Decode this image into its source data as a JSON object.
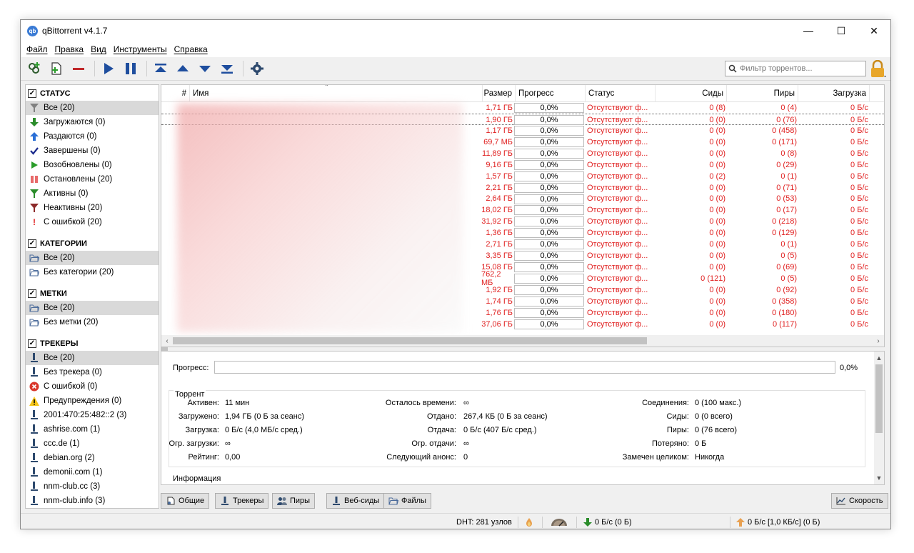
{
  "window": {
    "title": "qBittorrent v4.1.7",
    "controls": {
      "minimize": "—",
      "maximize": "☐",
      "close": "✕"
    }
  },
  "menu": [
    "Файл",
    "Правка",
    "Вид",
    "Инструменты",
    "Справка"
  ],
  "toolbar": {
    "buttons": [
      "add-link-icon",
      "add-file-icon",
      "remove-icon",
      "resume-icon",
      "pause-icon",
      "move-top-icon",
      "move-up-icon",
      "move-down-icon",
      "move-bottom-icon",
      "settings-icon"
    ],
    "filter_placeholder": "Фильтр торрентов...",
    "accent": "#1f4e9e"
  },
  "sidebar": {
    "status": {
      "title": "СТАТУС",
      "items": [
        {
          "label": "Все (20)",
          "icon": "filter-icon",
          "color": "#808080",
          "selected": true
        },
        {
          "label": "Загружаются (0)",
          "icon": "arrow-down-icon",
          "color": "#2a8c2a"
        },
        {
          "label": "Раздаются (0)",
          "icon": "arrow-up-icon",
          "color": "#2a6fd6"
        },
        {
          "label": "Завершены (0)",
          "icon": "checkmark-icon",
          "color": "#1a2a8c"
        },
        {
          "label": "Возобновлены (0)",
          "icon": "play-icon",
          "color": "#2a9c2a"
        },
        {
          "label": "Остановлены (20)",
          "icon": "pause-icon",
          "color": "#e86a6a"
        },
        {
          "label": "Активны (0)",
          "icon": "filter-icon",
          "color": "#2a8c2a"
        },
        {
          "label": "Неактивны (20)",
          "icon": "filter-icon",
          "color": "#8c2a2a"
        },
        {
          "label": "С ошибкой (20)",
          "icon": "exclamation-icon",
          "color": "#e02020"
        }
      ]
    },
    "categories": {
      "title": "КАТЕГОРИИ",
      "items": [
        {
          "label": "Все (20)",
          "selected": true
        },
        {
          "label": "Без категории (20)"
        }
      ]
    },
    "tags": {
      "title": "МЕТКИ",
      "items": [
        {
          "label": "Все (20)",
          "selected": true
        },
        {
          "label": "Без метки (20)"
        }
      ]
    },
    "trackers": {
      "title": "ТРЕКЕРЫ",
      "items": [
        {
          "label": "Все (20)",
          "icon": "tracker-icon",
          "selected": true
        },
        {
          "label": "Без трекера (0)",
          "icon": "tracker-icon"
        },
        {
          "label": "С ошибкой (0)",
          "icon": "error-circle-icon"
        },
        {
          "label": "Предупреждения (0)",
          "icon": "warning-icon"
        },
        {
          "label": "2001:470:25:482::2 (3)",
          "icon": "tracker-icon"
        },
        {
          "label": "ashrise.com (1)",
          "icon": "tracker-icon"
        },
        {
          "label": "ccc.de (1)",
          "icon": "tracker-icon"
        },
        {
          "label": "debian.org (2)",
          "icon": "tracker-icon"
        },
        {
          "label": "demonii.com (1)",
          "icon": "tracker-icon"
        },
        {
          "label": "nnm-club.cc (3)",
          "icon": "tracker-icon"
        },
        {
          "label": "nnm-club.info (3)",
          "icon": "tracker-icon"
        }
      ]
    }
  },
  "table": {
    "columns": {
      "num": "#",
      "name": "Имя",
      "size": "Размер",
      "progress": "Прогресс",
      "status": "Статус",
      "seeds": "Сиды",
      "peers": "Пиры",
      "down": "Загрузка"
    },
    "rows": [
      {
        "size": "1,71 ГБ",
        "progress": "0,0%",
        "status": "Отсутствуют ф...",
        "seeds": "0 (8)",
        "peers": "0 (4)",
        "down": "0 Б/с"
      },
      {
        "size": "1,90 ГБ",
        "progress": "0,0%",
        "status": "Отсутствуют ф...",
        "seeds": "0 (0)",
        "peers": "0 (76)",
        "down": "0 Б/с"
      },
      {
        "size": "1,17 ГБ",
        "progress": "0,0%",
        "status": "Отсутствуют ф...",
        "seeds": "0 (0)",
        "peers": "0 (458)",
        "down": "0 Б/с"
      },
      {
        "size": "69,7 МБ",
        "progress": "0,0%",
        "status": "Отсутствуют ф...",
        "seeds": "0 (0)",
        "peers": "0 (171)",
        "down": "0 Б/с"
      },
      {
        "size": "11,89 ГБ",
        "progress": "0,0%",
        "status": "Отсутствуют ф...",
        "seeds": "0 (0)",
        "peers": "0 (8)",
        "down": "0 Б/с"
      },
      {
        "size": "9,16 ГБ",
        "progress": "0,0%",
        "status": "Отсутствуют ф...",
        "seeds": "0 (0)",
        "peers": "0 (29)",
        "down": "0 Б/с"
      },
      {
        "size": "1,57 ГБ",
        "progress": "0,0%",
        "status": "Отсутствуют ф...",
        "seeds": "0 (2)",
        "peers": "0 (1)",
        "down": "0 Б/с"
      },
      {
        "size": "2,21 ГБ",
        "progress": "0,0%",
        "status": "Отсутствуют ф...",
        "seeds": "0 (0)",
        "peers": "0 (71)",
        "down": "0 Б/с"
      },
      {
        "size": "2,64 ГБ",
        "progress": "0,0%",
        "status": "Отсутствуют ф...",
        "seeds": "0 (0)",
        "peers": "0 (53)",
        "down": "0 Б/с"
      },
      {
        "size": "18,02 ГБ",
        "progress": "0,0%",
        "status": "Отсутствуют ф...",
        "seeds": "0 (0)",
        "peers": "0 (17)",
        "down": "0 Б/с"
      },
      {
        "size": "31,92 ГБ",
        "progress": "0,0%",
        "status": "Отсутствуют ф...",
        "seeds": "0 (0)",
        "peers": "0 (218)",
        "down": "0 Б/с"
      },
      {
        "size": "1,36 ГБ",
        "progress": "0,0%",
        "status": "Отсутствуют ф...",
        "seeds": "0 (0)",
        "peers": "0 (129)",
        "down": "0 Б/с"
      },
      {
        "size": "2,71 ГБ",
        "progress": "0,0%",
        "status": "Отсутствуют ф...",
        "seeds": "0 (0)",
        "peers": "0 (1)",
        "down": "0 Б/с"
      },
      {
        "size": "3,35 ГБ",
        "progress": "0,0%",
        "status": "Отсутствуют ф...",
        "seeds": "0 (0)",
        "peers": "0 (5)",
        "down": "0 Б/с"
      },
      {
        "size": "15,08 ГБ",
        "progress": "0,0%",
        "status": "Отсутствуют ф...",
        "seeds": "0 (0)",
        "peers": "0 (69)",
        "down": "0 Б/с"
      },
      {
        "size": "762,2 МБ",
        "progress": "0,0%",
        "status": "Отсутствуют ф...",
        "seeds": "0 (121)",
        "peers": "0 (5)",
        "down": "0 Б/с"
      },
      {
        "size": "1,92 ГБ",
        "progress": "0,0%",
        "status": "Отсутствуют ф...",
        "seeds": "0 (0)",
        "peers": "0 (92)",
        "down": "0 Б/с"
      },
      {
        "size": "1,74 ГБ",
        "progress": "0,0%",
        "status": "Отсутствуют ф...",
        "seeds": "0 (0)",
        "peers": "0 (358)",
        "down": "0 Б/с"
      },
      {
        "size": "1,76 ГБ",
        "progress": "0,0%",
        "status": "Отсутствуют ф...",
        "seeds": "0 (0)",
        "peers": "0 (180)",
        "down": "0 Б/с"
      },
      {
        "size": "37,06 ГБ",
        "progress": "0,0%",
        "status": "Отсутствуют ф...",
        "seeds": "0 (0)",
        "peers": "0 (117)",
        "down": "0 Б/с"
      }
    ],
    "row_color": "#e02020"
  },
  "properties": {
    "progress_label": "Прогресс:",
    "progress_value": "0,0%",
    "torrent_group": "Торрент",
    "info_group": "Информация",
    "fields": [
      {
        "label": "Активен:",
        "value": "11 мин"
      },
      {
        "label": "Загружено:",
        "value": "1,94 ГБ (0 Б за сеанс)"
      },
      {
        "label": "Загрузка:",
        "value": "0 Б/с (4,0 МБ/с сред.)"
      },
      {
        "label": "Огр. загрузки:",
        "value": "∞"
      },
      {
        "label": "Рейтинг:",
        "value": "0,00"
      },
      {
        "label": "Осталось времени:",
        "value": "∞"
      },
      {
        "label": "Отдано:",
        "value": "267,4 КБ (0 Б за сеанс)"
      },
      {
        "label": "Отдача:",
        "value": "0 Б/с (407 Б/с сред.)"
      },
      {
        "label": "Огр. отдачи:",
        "value": "∞"
      },
      {
        "label": "Следующий анонс:",
        "value": "0"
      },
      {
        "label": "Соединения:",
        "value": "0 (100 макс.)"
      },
      {
        "label": "Сиды:",
        "value": "0 (0 всего)"
      },
      {
        "label": "Пиры:",
        "value": "0 (76 всего)"
      },
      {
        "label": "Потеряно:",
        "value": "0 Б"
      },
      {
        "label": "Замечен целиком:",
        "value": "Никогда"
      }
    ]
  },
  "tabs": [
    "Общие",
    "Трекеры",
    "Пиры",
    "Веб-сиды",
    "Файлы"
  ],
  "speed_button": "Скорость",
  "statusbar": {
    "dht": "DHT: 281 узлов",
    "down": "0 Б/с (0 Б)",
    "up": "0 Б/с [1,0 КБ/с] (0 Б)"
  }
}
